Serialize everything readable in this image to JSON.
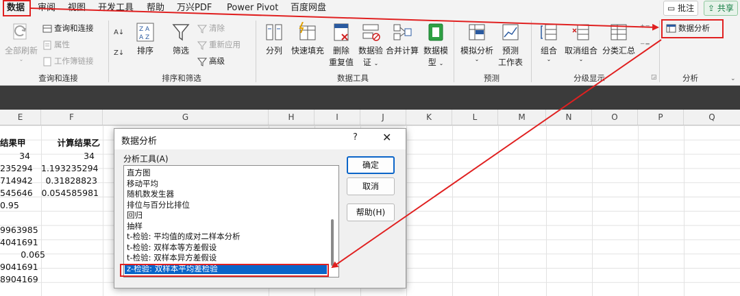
{
  "menubar": {
    "tabs": [
      "数据",
      "审阅",
      "视图",
      "开发工具",
      "帮助",
      "万兴PDF",
      "Power Pivot",
      "百度网盘"
    ],
    "comment_label": "批注",
    "share_label": "共享"
  },
  "ribbon": {
    "groups": {
      "query": {
        "label": "查询和连接",
        "refresh_all": "全部刷新",
        "query_connections": "查询和连接",
        "properties": "属性",
        "edit_links": "工作簿链接"
      },
      "sort_filter": {
        "label": "排序和筛选",
        "sort": "排序",
        "filter": "筛选",
        "clear": "清除",
        "reapply": "重新应用",
        "advanced": "高级"
      },
      "data_tools": {
        "label": "数据工具",
        "text_to_columns": "分列",
        "flash_fill": "快速填充",
        "remove_duplicates_1": "删除",
        "remove_duplicates_2": "重复值",
        "validation_1": "数据验",
        "validation_2": "证",
        "consolidate": "合并计算",
        "data_model_1": "数据模",
        "data_model_2": "型"
      },
      "forecast": {
        "label": "预测",
        "what_if": "模拟分析",
        "forecast_sheet_1": "预测",
        "forecast_sheet_2": "工作表"
      },
      "outline": {
        "label": "分级显示",
        "group": "组合",
        "ungroup": "取消组合",
        "subtotal": "分类汇总"
      },
      "analysis": {
        "label": "分析",
        "data_analysis": "数据分析"
      }
    }
  },
  "sheet": {
    "columns": [
      "E",
      "F",
      "G",
      "H",
      "I",
      "J",
      "K",
      "L",
      "M",
      "N",
      "O",
      "P",
      "Q"
    ],
    "col_e": [
      "结果甲",
      "34",
      "235294",
      "714942",
      "545646",
      "0.95",
      "",
      "9963985",
      "4041691",
      "0.065",
      "9041691",
      "8904169"
    ],
    "col_f": [
      "计算结果乙",
      "34",
      "1.193235294",
      "0.31828823",
      "0.054585981"
    ]
  },
  "dialog": {
    "title": "数据分析",
    "help": "?",
    "close": "✕",
    "tools_label": "分析工具(A)",
    "tools": [
      "直方图",
      "移动平均",
      "随机数发生器",
      "排位与百分比排位",
      "回归",
      "抽样",
      "t-检验: 平均值的成对二样本分析",
      "t-检验: 双样本等方差假设",
      "t-检验: 双样本异方差假设",
      "z-检验: 双样本平均差检验"
    ],
    "selected_tool": "z-检验: 双样本平均差检验",
    "ok": "确定",
    "cancel": "取消",
    "help_button": "帮助(H)"
  },
  "colors": {
    "accent_green": "#107c41",
    "annotation_red": "#e02020",
    "selection_blue": "#0a64c8"
  }
}
